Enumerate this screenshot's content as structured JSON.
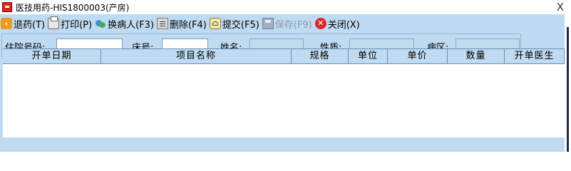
{
  "window": {
    "title": "医技用药-HIS1800003(产房)",
    "close_glyph": "X"
  },
  "toolbar": {
    "buttons": [
      {
        "label": "退药(T)",
        "icon": "back-icon",
        "enabled": true
      },
      {
        "label": "打印(P)",
        "icon": "printer-icon",
        "enabled": true
      },
      {
        "label": "换病人(F3)",
        "icon": "swap-patient-icon",
        "enabled": true
      },
      {
        "label": "删除(F4)",
        "icon": "delete-icon",
        "enabled": true
      },
      {
        "label": "提交(F5)",
        "icon": "submit-icon",
        "enabled": true
      },
      {
        "label": "保存(F9)",
        "icon": "save-icon",
        "enabled": false
      },
      {
        "label": "关闭(X)",
        "icon": "close-circle-icon",
        "enabled": true
      }
    ]
  },
  "patient": {
    "admission_no": {
      "label": "住院号码:",
      "value": ""
    },
    "bed_no": {
      "label": "床号:",
      "value": ""
    },
    "name": {
      "label": "姓名:",
      "value": ""
    },
    "nature": {
      "label": "性质:",
      "value": ""
    },
    "ward": {
      "label": "病区:",
      "value": ""
    }
  },
  "grid": {
    "columns": [
      "开单日期",
      "项目名称",
      "规格",
      "单位",
      "单价",
      "数量",
      "开单医生"
    ],
    "rows": []
  },
  "colors": {
    "window_bg": "#bfdbf1",
    "readonly_field_bg": "#c2dbef",
    "disabled_text": "#8a9ab0"
  }
}
